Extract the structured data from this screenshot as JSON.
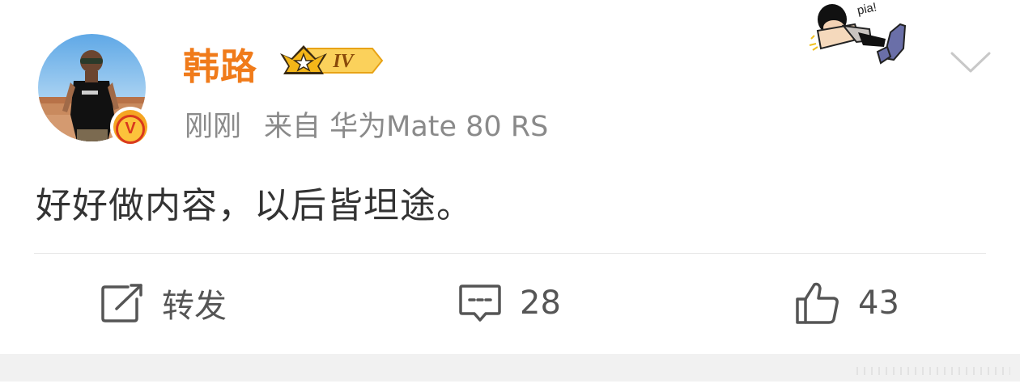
{
  "post": {
    "author": {
      "name": "韩路",
      "vip_level": "IV",
      "verified_badge": "V"
    },
    "meta": {
      "time": "刚刚",
      "source": "来自 华为Mate 80 RS"
    },
    "text": "好好做内容，以后皆坦途。",
    "sticker_text": "pia!",
    "actions": {
      "repost_label": "转发",
      "comment_count": "28",
      "like_count": "43"
    }
  },
  "colors": {
    "username": "#f07b1a",
    "meta": "#8a8a8a",
    "body_text": "#333333",
    "action_text": "#555555",
    "divider": "#e8e8e8",
    "footer_band": "#f1f1f1"
  },
  "icons": [
    "verified-icon",
    "vip-crown-icon",
    "chevron-down-icon",
    "repost-icon",
    "comment-icon",
    "like-icon"
  ]
}
